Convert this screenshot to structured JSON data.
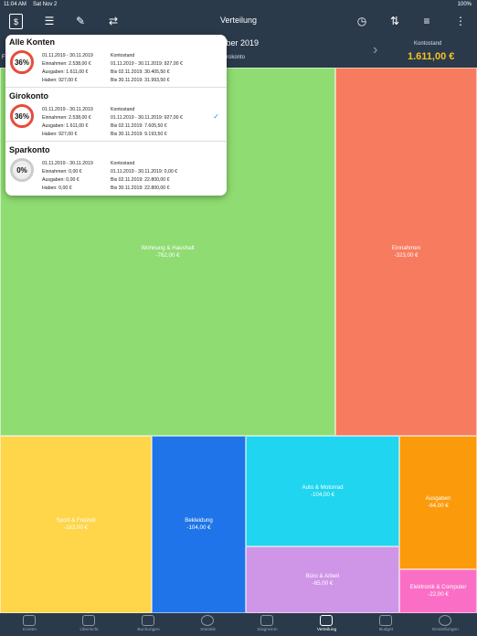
{
  "status": {
    "time": "11:04 AM",
    "date": "Sat Nov 2",
    "battery": "100%"
  },
  "nav": {
    "title": "Verteilung"
  },
  "header": {
    "period": "mber 2019",
    "account_left": "Fi",
    "account": "Girokonto",
    "balance_label": "Kontostand",
    "balance_value": "1.611,00 €"
  },
  "treemap": [
    {
      "label": "Wohnung & Haushalt",
      "value": "-762,00 €",
      "color": "#8fdc72"
    },
    {
      "label": "Einnahmen",
      "value": "-323,00 €",
      "color": "#f77b5e"
    },
    {
      "label": "Sport & Freizeit",
      "value": "-162,00 €",
      "color": "#ffd54a"
    },
    {
      "label": "Bekleidung",
      "value": "-104,00 €",
      "color": "#1e74e8"
    },
    {
      "label": "Auto & Motorrad",
      "value": "-104,00 €",
      "color": "#1fd5f0"
    },
    {
      "label": "Ausgaben",
      "value": "-64,00 €",
      "color": "#fb9a0b"
    },
    {
      "label": "Büro & Arbeit",
      "value": "-65,00 €",
      "color": "#cf95e6"
    },
    {
      "label": "Elektronik & Computer",
      "value": "-22,00 €",
      "color": "#fa6fc5"
    }
  ],
  "accounts": [
    {
      "name": "Alle Konten",
      "pct": "36%",
      "ring": "#e74c3c",
      "c1": [
        "01.11.2019 - 30.11.2019",
        "Einnahmen: 2.538,00 €",
        "Ausgaben: 1.611,00 €",
        "Haben: 927,00 €"
      ],
      "c2": [
        "Kontostand",
        "01.11.2019 - 30.11.2019: 927,00 €",
        "Bis 02.11.2019: 30.405,50 €",
        "Bis 30.11.2019: 31.993,50 €"
      ],
      "checked": false
    },
    {
      "name": "Girokonto",
      "pct": "36%",
      "ring": "#e74c3c",
      "c1": [
        "01.11.2019 - 30.11.2019",
        "Einnahmen: 2.538,00 €",
        "Ausgaben: 1.611,00 €",
        "Haben: 927,00 €"
      ],
      "c2": [
        "Kontostand",
        "01.11.2019 - 30.11.2019: 927,00 €",
        "Bis 02.11.2019: 7.605,50 €",
        "Bis 30.11.2019: 9.193,50 €"
      ],
      "checked": true
    },
    {
      "name": "Sparkonto",
      "pct": "0%",
      "ring": "#cccccc",
      "c1": [
        "01.11.2019 - 30.11.2019",
        "Einnahmen: 0,00 €",
        "Ausgaben: 0,00 €",
        "Haben: 0,00 €"
      ],
      "c2": [
        "Kontostand",
        "01.11.2019 - 30.11.2019: 0,00 €",
        "Bis 02.11.2019: 22.800,00 €",
        "Bis 30.11.2019: 22.800,00 €"
      ],
      "checked": false
    }
  ],
  "tabs": [
    "Konten",
    "Übersicht",
    "Buchungen",
    "Statistik",
    "Diagramm",
    "Verteilung",
    "Budget",
    "Einstellungen"
  ],
  "active_tab": 5
}
